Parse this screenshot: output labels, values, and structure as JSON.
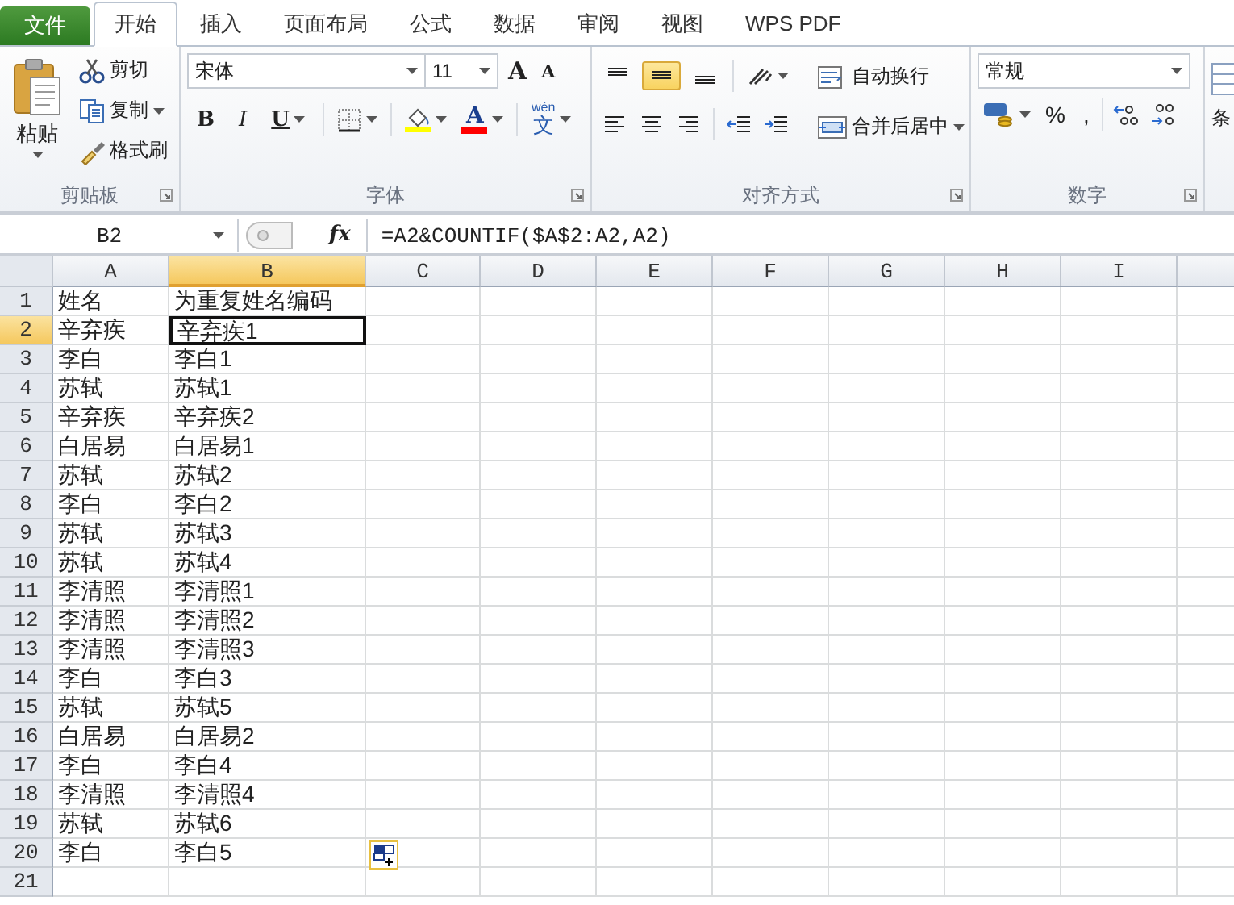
{
  "tabs": [
    {
      "label": "文件",
      "kind": "file",
      "selected": false
    },
    {
      "label": "开始",
      "kind": "tab",
      "selected": true
    },
    {
      "label": "插入",
      "kind": "tab",
      "selected": false
    },
    {
      "label": "页面布局",
      "kind": "tab",
      "selected": false
    },
    {
      "label": "公式",
      "kind": "tab",
      "selected": false
    },
    {
      "label": "数据",
      "kind": "tab",
      "selected": false
    },
    {
      "label": "审阅",
      "kind": "tab",
      "selected": false
    },
    {
      "label": "视图",
      "kind": "tab",
      "selected": false
    },
    {
      "label": "WPS PDF",
      "kind": "tab",
      "selected": false
    }
  ],
  "ribbon": {
    "clipboard": {
      "title": "剪贴板",
      "paste": "粘贴",
      "cut": "剪切",
      "copy": "复制",
      "format_painter": "格式刷"
    },
    "font": {
      "title": "字体",
      "font_name": "宋体",
      "font_size": "11",
      "grow": "A",
      "shrink": "A",
      "bold": "B",
      "italic": "I",
      "underline": "U",
      "font_color": "A",
      "phonetic_top": "wén",
      "phonetic": "文"
    },
    "alignment": {
      "title": "对齐方式",
      "vertical": [
        {
          "kind": "top",
          "selected": false
        },
        {
          "kind": "middle",
          "selected": true
        },
        {
          "kind": "bottom",
          "selected": false
        }
      ],
      "wrap_text": "自动换行",
      "merge_center": "合并后居中"
    },
    "number": {
      "title": "数字",
      "format": "常规",
      "percent": "%",
      "comma": ","
    },
    "styles": {
      "label": "条"
    }
  },
  "name_box": "B2",
  "fx": "fx",
  "formula": "=A2&COUNTIF($A$2:A2,A2)",
  "columns": [
    {
      "label": "A",
      "selected": false
    },
    {
      "label": "B",
      "selected": true
    },
    {
      "label": "C",
      "selected": false
    },
    {
      "label": "D",
      "selected": false
    },
    {
      "label": "E",
      "selected": false
    },
    {
      "label": "F",
      "selected": false
    },
    {
      "label": "G",
      "selected": false
    },
    {
      "label": "H",
      "selected": false
    },
    {
      "label": "I",
      "selected": false
    }
  ],
  "rows": [
    {
      "number": "1",
      "selected": false,
      "cells": [
        "姓名",
        "为重复姓名编码"
      ]
    },
    {
      "number": "2",
      "selected": true,
      "cells": [
        "辛弃疾",
        "辛弃疾1"
      ]
    },
    {
      "number": "3",
      "selected": false,
      "cells": [
        "李白",
        "李白1"
      ]
    },
    {
      "number": "4",
      "selected": false,
      "cells": [
        "苏轼",
        "苏轼1"
      ]
    },
    {
      "number": "5",
      "selected": false,
      "cells": [
        "辛弃疾",
        "辛弃疾2"
      ]
    },
    {
      "number": "6",
      "selected": false,
      "cells": [
        "白居易",
        "白居易1"
      ]
    },
    {
      "number": "7",
      "selected": false,
      "cells": [
        "苏轼",
        "苏轼2"
      ]
    },
    {
      "number": "8",
      "selected": false,
      "cells": [
        "李白",
        "李白2"
      ]
    },
    {
      "number": "9",
      "selected": false,
      "cells": [
        "苏轼",
        "苏轼3"
      ]
    },
    {
      "number": "10",
      "selected": false,
      "cells": [
        "苏轼",
        "苏轼4"
      ]
    },
    {
      "number": "11",
      "selected": false,
      "cells": [
        "李清照",
        "李清照1"
      ]
    },
    {
      "number": "12",
      "selected": false,
      "cells": [
        "李清照",
        "李清照2"
      ]
    },
    {
      "number": "13",
      "selected": false,
      "cells": [
        "李清照",
        "李清照3"
      ]
    },
    {
      "number": "14",
      "selected": false,
      "cells": [
        "李白",
        "李白3"
      ]
    },
    {
      "number": "15",
      "selected": false,
      "cells": [
        "苏轼",
        "苏轼5"
      ]
    },
    {
      "number": "16",
      "selected": false,
      "cells": [
        "白居易",
        "白居易2"
      ]
    },
    {
      "number": "17",
      "selected": false,
      "cells": [
        "李白",
        "李白4"
      ]
    },
    {
      "number": "18",
      "selected": false,
      "cells": [
        "李清照",
        "李清照4"
      ]
    },
    {
      "number": "19",
      "selected": false,
      "cells": [
        "苏轼",
        "苏轼6"
      ]
    },
    {
      "number": "20",
      "selected": false,
      "cells": [
        "李白",
        "李白5"
      ]
    },
    {
      "number": "21",
      "selected": false,
      "cells": []
    }
  ]
}
